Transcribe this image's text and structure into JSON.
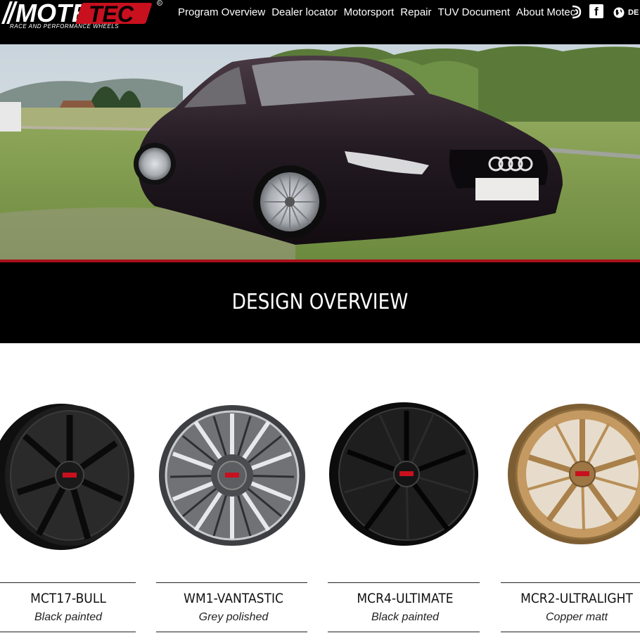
{
  "brand": {
    "logo_text": "MOTEC",
    "tagline": "RACE AND PERFORMANCE WHEELS",
    "registered": "®",
    "colors": {
      "red": "#c8101e",
      "black": "#000000",
      "white": "#ffffff"
    }
  },
  "nav": {
    "items": [
      {
        "label": "Program Overview"
      },
      {
        "label": "Dealer locator"
      },
      {
        "label": "Motorsport"
      },
      {
        "label": "Repair"
      },
      {
        "label": "TUV Document"
      },
      {
        "label": "About Motec"
      }
    ],
    "icons": [
      "d-logo-icon",
      "facebook-icon",
      "globe-icon"
    ],
    "facebook_glyph": "f",
    "language": "DE"
  },
  "hero": {
    "image": "black-audi-sportback-on-grass"
  },
  "section": {
    "title": "DESIGN OVERVIEW"
  },
  "products": [
    {
      "name": "MCT17-BULL",
      "finish": "Black painted",
      "color": "#1a1a1a"
    },
    {
      "name": "WM1-VANTASTIC",
      "finish": "Grey polished",
      "color": "#5a5b5e"
    },
    {
      "name": "MCR4-ULTIMATE",
      "finish": "Black painted",
      "color": "#151515"
    },
    {
      "name": "MCR2-ULTRALIGHT",
      "finish": "Copper matt",
      "color": "#b08650"
    }
  ]
}
